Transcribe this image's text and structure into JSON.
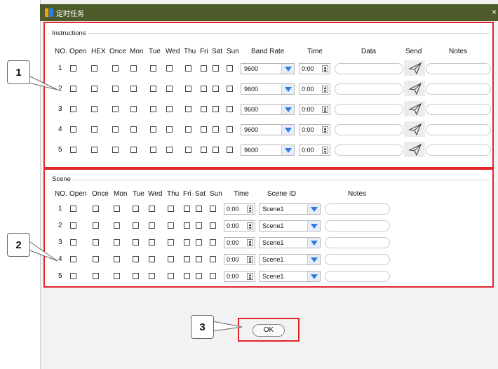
{
  "window": {
    "title": "定时任务",
    "close_glyph": "×"
  },
  "instructions": {
    "group_label": "Instructions",
    "headers": {
      "no": "NO.",
      "open": "Open",
      "hex": "HEX",
      "once": "Once",
      "mon": "Mon",
      "tue": "Tue",
      "wed": "Wed",
      "thu": "Thu",
      "fri": "Fri",
      "sat": "Sat",
      "sun": "Sun",
      "band_rate": "Band Rate",
      "time": "Time",
      "data": "Data",
      "send": "Send",
      "notes": "Notes"
    },
    "rows": [
      {
        "no": "1",
        "band_rate": "9600",
        "time": "0:00"
      },
      {
        "no": "2",
        "band_rate": "9600",
        "time": "0:00"
      },
      {
        "no": "3",
        "band_rate": "9600",
        "time": "0:00"
      },
      {
        "no": "4",
        "band_rate": "9600",
        "time": "0:00"
      },
      {
        "no": "5",
        "band_rate": "9600",
        "time": "0:00"
      }
    ]
  },
  "scene": {
    "group_label": "Scene",
    "headers": {
      "no": "NO.",
      "open": "Open",
      "once": "Once",
      "mon": "Mon",
      "tue": "Tue",
      "wed": "Wed",
      "thu": "Thu",
      "fri": "Fri",
      "sat": "Sat",
      "sun": "Sun",
      "time": "Time",
      "scene_id": "Scene ID",
      "notes": "Notes"
    },
    "rows": [
      {
        "no": "1",
        "time": "0:00",
        "scene_id": "Scene1"
      },
      {
        "no": "2",
        "time": "0:00",
        "scene_id": "Scene1"
      },
      {
        "no": "3",
        "time": "0:00",
        "scene_id": "Scene1"
      },
      {
        "no": "4",
        "time": "0:00",
        "scene_id": "Scene1"
      },
      {
        "no": "5",
        "time": "0:00",
        "scene_id": "Scene1"
      }
    ]
  },
  "ok_label": "OK",
  "callouts": [
    "1",
    "2",
    "3"
  ],
  "colors": {
    "titlebar": "#4d5b2a",
    "highlight": "#e1252b",
    "dropdown_arrow": "#2f7be0"
  },
  "icons": {
    "send": "paper-plane-icon",
    "dropdown": "chevron-down-icon",
    "spinner": "spin-arrows-icon"
  }
}
